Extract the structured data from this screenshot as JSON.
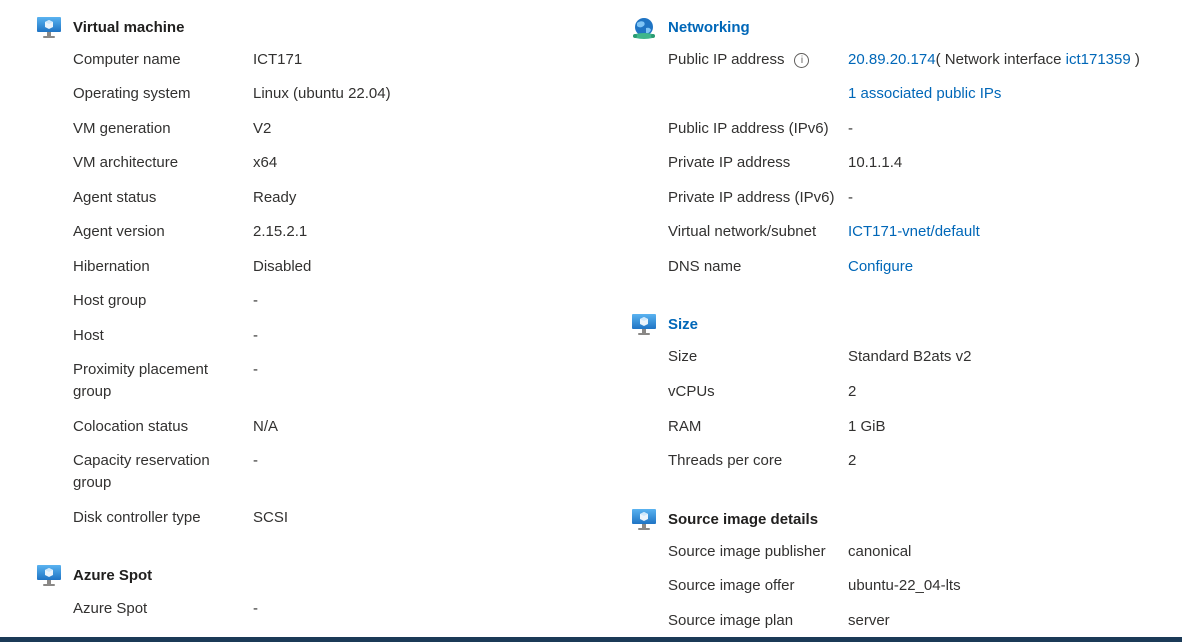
{
  "vm": {
    "title": "Virtual machine",
    "rows": [
      {
        "label": "Computer name",
        "value": "ICT171"
      },
      {
        "label": "Operating system",
        "value": "Linux (ubuntu 22.04)"
      },
      {
        "label": "VM generation",
        "value": "V2"
      },
      {
        "label": "VM architecture",
        "value": "x64"
      },
      {
        "label": "Agent status",
        "value": "Ready"
      },
      {
        "label": "Agent version",
        "value": "2.15.2.1"
      },
      {
        "label": "Hibernation",
        "value": "Disabled"
      },
      {
        "label": "Host group",
        "value": "-"
      },
      {
        "label": "Host",
        "value": "-"
      },
      {
        "label": "Proximity placement group",
        "value": "-"
      },
      {
        "label": "Colocation status",
        "value": "N/A"
      },
      {
        "label": "Capacity reservation group",
        "value": "-"
      },
      {
        "label": "Disk controller type",
        "value": "SCSI"
      }
    ]
  },
  "spot": {
    "title": "Azure Spot",
    "rows": [
      {
        "label": "Azure Spot",
        "value": "-"
      }
    ]
  },
  "net": {
    "title": "Networking",
    "public_ip_label": "Public IP address",
    "info_glyph": "i",
    "public_ip": "20.89.20.174",
    "nic_prefix": "( Network interface ",
    "nic_link": "ict171359",
    "nic_suffix": " )",
    "assoc_ips": "1 associated public IPs",
    "rows": [
      {
        "label": "Public IP address (IPv6)",
        "value": "-"
      },
      {
        "label": "Private IP address",
        "value": "10.1.1.4"
      },
      {
        "label": "Private IP address (IPv6)",
        "value": "-"
      },
      {
        "label": "Virtual network/subnet",
        "value": "ICT171-vnet/default"
      },
      {
        "label": "DNS name",
        "value": "Configure"
      }
    ]
  },
  "size": {
    "title": "Size",
    "rows": [
      {
        "label": "Size",
        "value": "Standard B2ats v2"
      },
      {
        "label": "vCPUs",
        "value": "2"
      },
      {
        "label": "RAM",
        "value": "1 GiB"
      },
      {
        "label": "Threads per core",
        "value": "2"
      }
    ]
  },
  "image": {
    "title": "Source image details",
    "rows": [
      {
        "label": "Source image publisher",
        "value": "canonical"
      },
      {
        "label": "Source image offer",
        "value": "ubuntu-22_04-lts"
      },
      {
        "label": "Source image plan",
        "value": "server"
      }
    ]
  },
  "colors": {
    "link": "#0067b8",
    "text": "#323130",
    "monitor_blue": "#2e8ad8",
    "bottom_bar": "#1b3a57"
  },
  "icons": {
    "vm": "monitor-icon",
    "net": "network-globe-icon",
    "info": "info-icon"
  }
}
